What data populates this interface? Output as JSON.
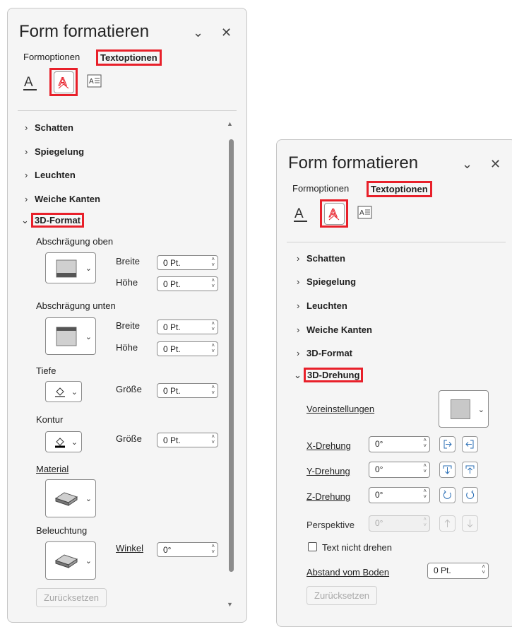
{
  "left_panel": {
    "title": "Form formatieren",
    "tabs": {
      "shape_options": "Formoptionen",
      "text_options": "Textoptionen"
    },
    "sections": {
      "shadow": "Schatten",
      "reflection": "Spiegelung",
      "glow": "Leuchten",
      "soft_edges": "Weiche Kanten",
      "format_3d": "3D-Format"
    },
    "bevel_top": {
      "label": "Abschrägung oben",
      "width_label": "Breite",
      "width_value": "0 Pt.",
      "height_label": "Höhe",
      "height_value": "0 Pt."
    },
    "bevel_bottom": {
      "label": "Abschrägung unten",
      "width_label": "Breite",
      "width_value": "0 Pt.",
      "height_label": "Höhe",
      "height_value": "0 Pt."
    },
    "depth": {
      "label": "Tiefe",
      "size_label": "Größe",
      "size_value": "0 Pt."
    },
    "contour": {
      "label": "Kontur",
      "size_label": "Größe",
      "size_value": "0 Pt."
    },
    "material": {
      "label": "Material"
    },
    "lighting": {
      "label": "Beleuchtung",
      "angle_label": "Winkel",
      "angle_value": "0°"
    },
    "reset": "Zurücksetzen"
  },
  "right_panel": {
    "title": "Form formatieren",
    "tabs": {
      "shape_options": "Formoptionen",
      "text_options": "Textoptionen"
    },
    "sections": {
      "shadow": "Schatten",
      "reflection": "Spiegelung",
      "glow": "Leuchten",
      "soft_edges": "Weiche Kanten",
      "format_3d": "3D-Format",
      "rotation_3d": "3D-Drehung"
    },
    "presets_label": "Voreinstellungen",
    "x_rotation": {
      "label": "X-Drehung",
      "value": "0°"
    },
    "y_rotation": {
      "label": "Y-Drehung",
      "value": "0°"
    },
    "z_rotation": {
      "label": "Z-Drehung",
      "value": "0°"
    },
    "perspective": {
      "label": "Perspektive",
      "value": "0°"
    },
    "keep_text_flat": "Text nicht drehen",
    "distance_from_ground": {
      "label": "Abstand vom Boden",
      "value": "0 Pt."
    },
    "reset": "Zurücksetzen"
  },
  "colors": {
    "highlight": "#e8202a",
    "text_icon": "#e8202a",
    "panel_bg": "#f5f5f5"
  }
}
